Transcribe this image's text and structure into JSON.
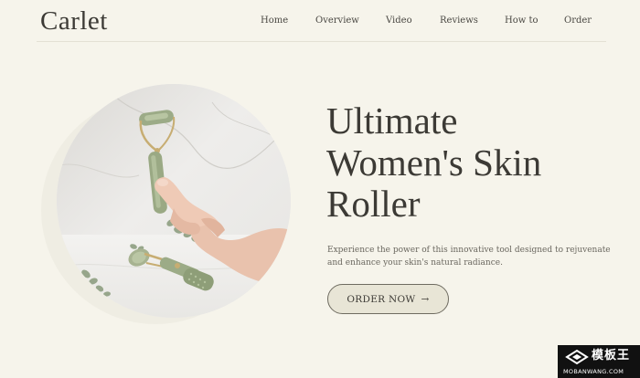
{
  "brand": {
    "name": "Carlet"
  },
  "nav": {
    "items": [
      {
        "label": "Home"
      },
      {
        "label": "Overview"
      },
      {
        "label": "Video"
      },
      {
        "label": "Reviews"
      },
      {
        "label": "How to"
      },
      {
        "label": "Order"
      }
    ]
  },
  "hero": {
    "title_lines": [
      "Ultimate",
      "Women's Skin",
      "Roller"
    ],
    "description_lines": [
      "Experience the power of this innovative tool designed to rejuvenate",
      "and enhance your skin's natural radiance."
    ],
    "cta_label": "ORDER NOW",
    "cta_arrow": "→"
  },
  "watermark": {
    "name": "模板王",
    "url": "MOBANWANG.COM"
  },
  "colors": {
    "background": "#f6f4eb",
    "text": "#3c3a35",
    "button_fill": "#e8e5d6",
    "roller_jade": "#9cab87",
    "roller_gold": "#c7ad72"
  }
}
